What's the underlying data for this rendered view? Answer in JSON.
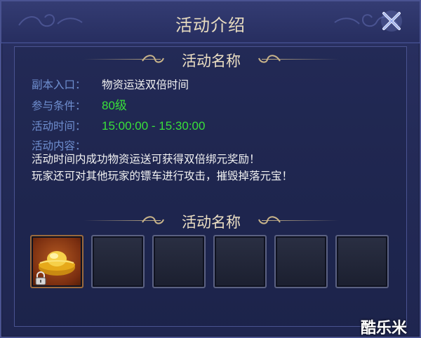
{
  "window": {
    "title": "活动介绍",
    "close_icon": "close-x-icon"
  },
  "section1": {
    "title": "活动名称"
  },
  "info": {
    "entry_label": "副本入口：",
    "entry_value": "物资运送双倍时间",
    "condition_label": "参与条件：",
    "condition_value": "80级",
    "time_label": "活动时间：",
    "time_value": "15:00:00 - 15:30:00",
    "content_label": "活动内容：",
    "content_line1": "活动时间内成功物资运送可获得双倍绑元奖励！",
    "content_line2": "玩家还可对其他玩家的镖车进行攻击，摧毁掉落元宝！"
  },
  "section2": {
    "title": "活动名称"
  },
  "rewards": {
    "slots": [
      {
        "item": "gold-ingot-icon",
        "locked": true
      },
      {
        "item": ""
      },
      {
        "item": ""
      },
      {
        "item": ""
      },
      {
        "item": ""
      },
      {
        "item": ""
      }
    ]
  },
  "watermark": {
    "text": "酷乐米"
  },
  "colors": {
    "label": "#6f8fd0",
    "value_white": "#f2f2f2",
    "value_green": "#39e03a",
    "title": "#ecdfc3"
  }
}
